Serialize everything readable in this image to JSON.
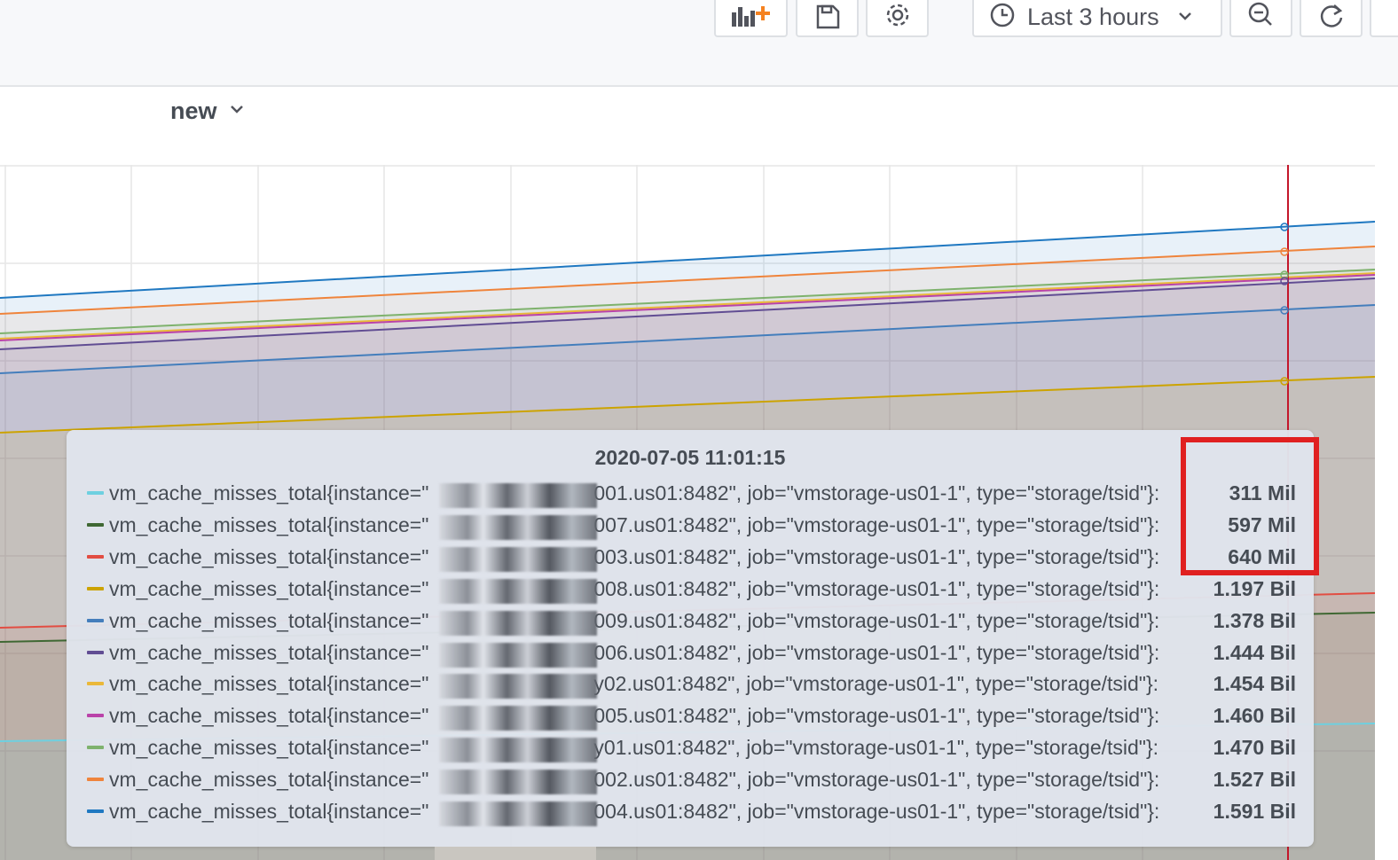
{
  "toolbar": {
    "add_panel_icon": "add-panel-icon",
    "save_icon": "save-icon",
    "settings_icon": "gear-icon",
    "time_range_label": "Last 3 hours",
    "zoom_out_icon": "zoom-out-icon",
    "refresh_icon": "refresh-icon",
    "accent_color": "#f58220"
  },
  "variable": {
    "label": "new",
    "icon": "chevron-down-icon"
  },
  "tooltip": {
    "timestamp": "2020-07-05 11:01:15",
    "rows": [
      {
        "prefix": "vm_cache_misses_total{instance=\"",
        "suffix": "001.us01:8482\", job=\"vmstorage-us01-1\", type=\"storage/tsid\"}:",
        "value": "311 Mil",
        "color": "#6ed0e0"
      },
      {
        "prefix": "vm_cache_misses_total{instance=\"",
        "suffix": "007.us01:8482\", job=\"vmstorage-us01-1\", type=\"storage/tsid\"}:",
        "value": "597 Mil",
        "color": "#3f6833"
      },
      {
        "prefix": "vm_cache_misses_total{instance=\"",
        "suffix": "003.us01:8482\", job=\"vmstorage-us01-1\", type=\"storage/tsid\"}:",
        "value": "640 Mil",
        "color": "#e24d42"
      },
      {
        "prefix": "vm_cache_misses_total{instance=\"",
        "suffix": "008.us01:8482\", job=\"vmstorage-us01-1\", type=\"storage/tsid\"}:",
        "value": "1.197 Bil",
        "color": "#cca300"
      },
      {
        "prefix": "vm_cache_misses_total{instance=\"",
        "suffix": "009.us01:8482\", job=\"vmstorage-us01-1\", type=\"storage/tsid\"}:",
        "value": "1.378 Bil",
        "color": "#447ebc"
      },
      {
        "prefix": "vm_cache_misses_total{instance=\"",
        "suffix": "006.us01:8482\", job=\"vmstorage-us01-1\", type=\"storage/tsid\"}:",
        "value": "1.444 Bil",
        "color": "#614d93"
      },
      {
        "prefix": "vm_cache_misses_total{instance=\"",
        "suffix": "y02.us01:8482\", job=\"vmstorage-us01-1\", type=\"storage/tsid\"}:",
        "value": "1.454 Bil",
        "color": "#eab839"
      },
      {
        "prefix": "vm_cache_misses_total{instance=\"",
        "suffix": "005.us01:8482\", job=\"vmstorage-us01-1\", type=\"storage/tsid\"}:",
        "value": "1.460 Bil",
        "color": "#ba43a9"
      },
      {
        "prefix": "vm_cache_misses_total{instance=\"",
        "suffix": "y01.us01:8482\", job=\"vmstorage-us01-1\", type=\"storage/tsid\"}:",
        "value": "1.470 Bil",
        "color": "#7eb26d"
      },
      {
        "prefix": "vm_cache_misses_total{instance=\"",
        "suffix": "002.us01:8482\", job=\"vmstorage-us01-1\", type=\"storage/tsid\"}:",
        "value": "1.527 Bil",
        "color": "#ef843c"
      },
      {
        "prefix": "vm_cache_misses_total{instance=\"",
        "suffix": "004.us01:8482\", job=\"vmstorage-us01-1\", type=\"storage/tsid\"}:",
        "value": "1.591 Bil",
        "color": "#1f78c1"
      }
    ]
  },
  "highlight_color": "#e02020"
}
